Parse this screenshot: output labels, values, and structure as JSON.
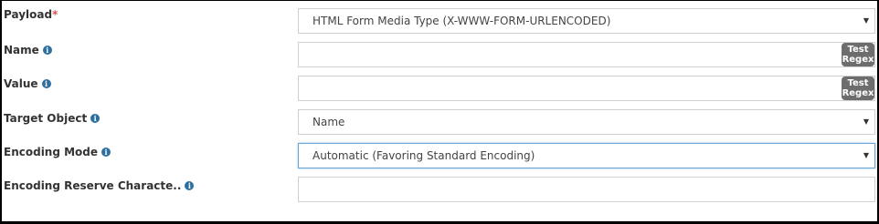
{
  "form": {
    "payload": {
      "label": "Payload",
      "required_mark": "*",
      "value": "HTML Form Media Type (X-WWW-FORM-URLENCODED)"
    },
    "name": {
      "label": "Name",
      "value": "",
      "regex_button": [
        "Test",
        "Regex"
      ]
    },
    "value": {
      "label": "Value",
      "value": "",
      "regex_button": [
        "Test",
        "Regex"
      ]
    },
    "target_object": {
      "label": "Target Object",
      "value": "Name"
    },
    "encoding_mode": {
      "label": "Encoding Mode",
      "value": "Automatic (Favoring Standard Encoding)"
    },
    "encoding_reserve": {
      "label": "Encoding Reserve Characte..",
      "value": ""
    }
  },
  "icons": {
    "info": "info-circle-icon",
    "dropdown": "caret-down-icon"
  },
  "colors": {
    "required": "#d9534f",
    "info_icon": "#2d6f9f",
    "regex_button": "#6d6d6d",
    "focus_border": "#6aa6d6"
  }
}
